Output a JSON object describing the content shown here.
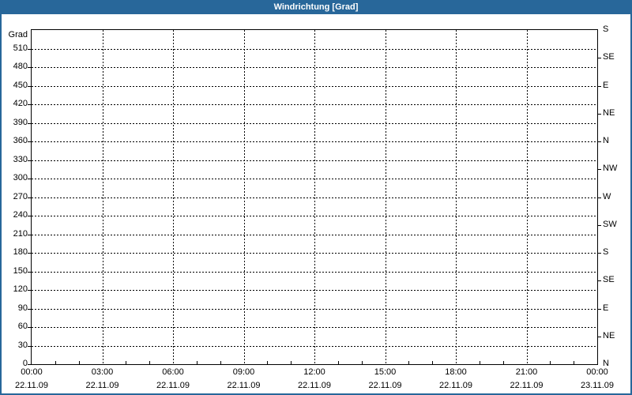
{
  "window": {
    "title": "Windrichtung [Grad]"
  },
  "colors": {
    "titlebar_bg": "#28679a",
    "titlebar_text": "#ffffff",
    "frame_border": "#28679a",
    "plot_border": "#000000",
    "grid": "#000000",
    "label_text": "#000000",
    "background": "#ffffff"
  },
  "chart_data": {
    "type": "line",
    "title": "Windrichtung [Grad]",
    "ylabel": "Grad",
    "xlabel": "",
    "ylim": [
      0,
      540
    ],
    "y_tick_step": 30,
    "grid": true,
    "grid_style": "dashed",
    "legend": false,
    "series": [],
    "y_ticks": [
      510,
      480,
      450,
      420,
      390,
      360,
      330,
      300,
      270,
      240,
      210,
      180,
      150,
      120,
      90,
      60,
      30,
      0
    ],
    "right_axis": [
      {
        "deg": 540,
        "label": "S"
      },
      {
        "deg": 495,
        "label": "SE"
      },
      {
        "deg": 450,
        "label": "E"
      },
      {
        "deg": 405,
        "label": "NE"
      },
      {
        "deg": 360,
        "label": "N"
      },
      {
        "deg": 315,
        "label": "NW"
      },
      {
        "deg": 270,
        "label": "W"
      },
      {
        "deg": 225,
        "label": "SW"
      },
      {
        "deg": 180,
        "label": "S"
      },
      {
        "deg": 135,
        "label": "SE"
      },
      {
        "deg": 90,
        "label": "E"
      },
      {
        "deg": 45,
        "label": "NE"
      },
      {
        "deg": 0,
        "label": "N"
      }
    ],
    "x_ticks": [
      {
        "time": "00:00",
        "date": "22.11.09"
      },
      {
        "time": "03:00",
        "date": "22.11.09"
      },
      {
        "time": "06:00",
        "date": "22.11.09"
      },
      {
        "time": "09:00",
        "date": "22.11.09"
      },
      {
        "time": "12:00",
        "date": "22.11.09"
      },
      {
        "time": "15:00",
        "date": "22.11.09"
      },
      {
        "time": "18:00",
        "date": "22.11.09"
      },
      {
        "time": "21:00",
        "date": "22.11.09"
      },
      {
        "time": "00:00",
        "date": "23.11.09"
      }
    ],
    "x_minor_ticks_per_hour": 1,
    "x_hours_total": 24
  }
}
